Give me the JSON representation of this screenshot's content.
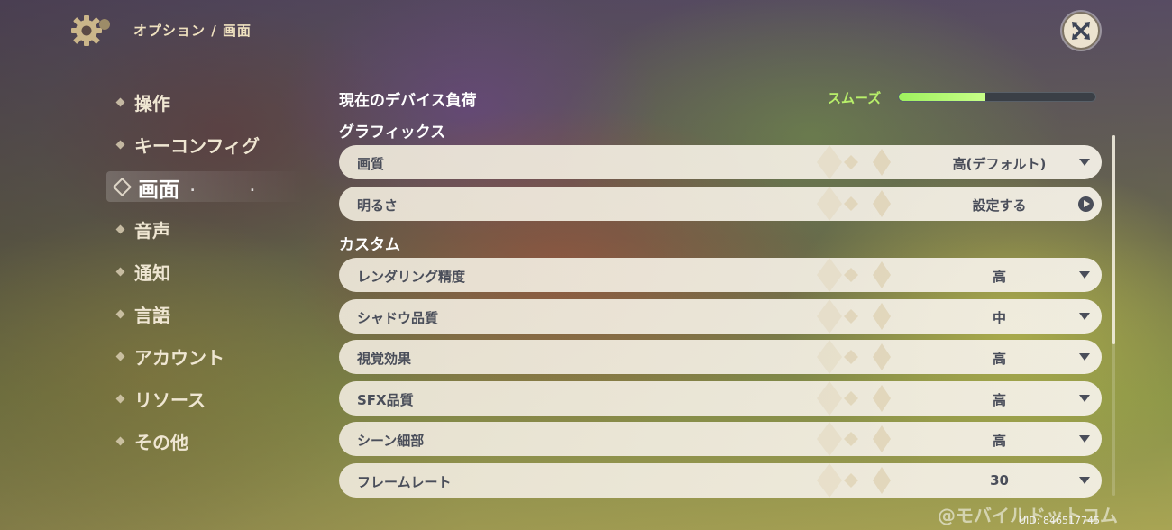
{
  "header": {
    "breadcrumb": "オプション / 画面",
    "gear_icon": "gear-icon",
    "close_icon": "close-icon"
  },
  "sidebar": {
    "items": [
      {
        "label": "操作",
        "active": false
      },
      {
        "label": "キーコンフィグ",
        "active": false
      },
      {
        "label": "画面",
        "active": true
      },
      {
        "label": "音声",
        "active": false
      },
      {
        "label": "通知",
        "active": false
      },
      {
        "label": "言語",
        "active": false
      },
      {
        "label": "アカウント",
        "active": false
      },
      {
        "label": "リソース",
        "active": false
      },
      {
        "label": "その他",
        "active": false
      }
    ],
    "active_dots": ". ."
  },
  "device_load": {
    "title": "現在のデバイス負荷",
    "status": "スムーズ",
    "level": 0.44,
    "status_color": "#b8ef6a"
  },
  "graphics": {
    "section_title": "グラフィックス",
    "quality": {
      "label": "画質",
      "value": "高(デフォルト)"
    },
    "brightness": {
      "label": "明るさ",
      "value": "設定する"
    }
  },
  "custom": {
    "section_title": "カスタム",
    "settings": [
      {
        "label": "レンダリング精度",
        "value": "高"
      },
      {
        "label": "シャドウ品質",
        "value": "中"
      },
      {
        "label": "視覚効果",
        "value": "高"
      },
      {
        "label": "SFX品質",
        "value": "高"
      },
      {
        "label": "シーン細部",
        "value": "高"
      },
      {
        "label": "フレームレート",
        "value": "30"
      }
    ]
  },
  "footer": {
    "watermark": "@モバイルドットコム",
    "uid": "UID: 846517745"
  }
}
